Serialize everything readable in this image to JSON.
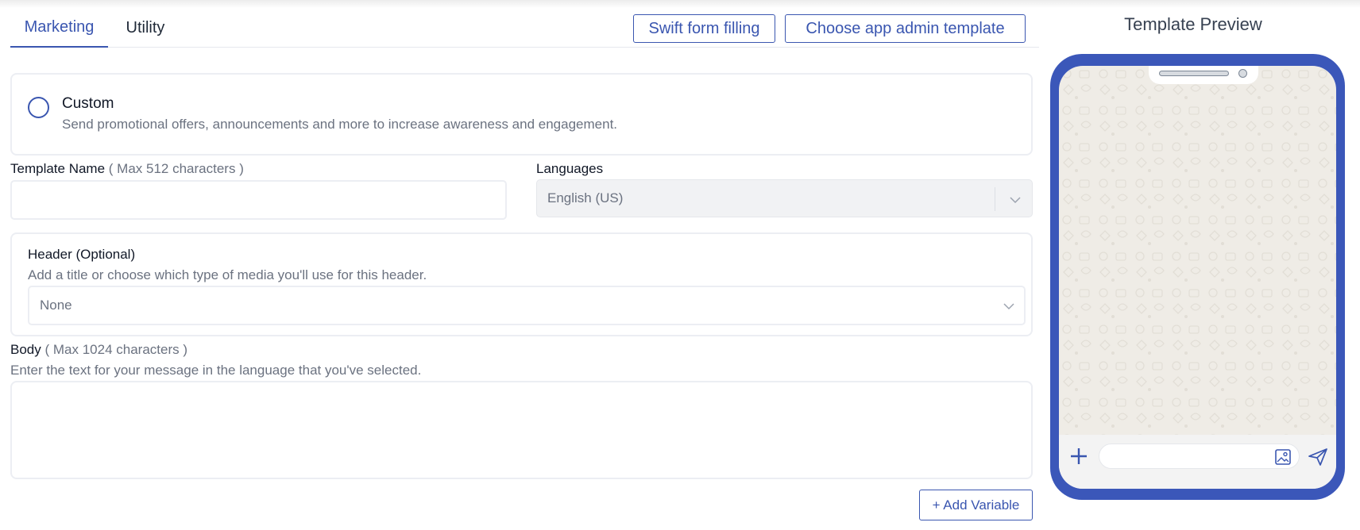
{
  "tabs": [
    {
      "label": "Marketing",
      "active": true
    },
    {
      "label": "Utility",
      "active": false
    }
  ],
  "toolbar": {
    "swift_label": "Swift form filling",
    "choose_template_label": "Choose app admin template"
  },
  "category": {
    "title": "Custom",
    "description": "Send promotional offers, announcements and more to increase awareness and engagement."
  },
  "template_name": {
    "label": "Template Name",
    "hint": "( Max 512 characters )",
    "value": ""
  },
  "languages": {
    "label": "Languages",
    "selected": "English (US)"
  },
  "header": {
    "title": "Header (Optional)",
    "description": "Add a title or choose which type of media you'll use for this header.",
    "selected": "None"
  },
  "body": {
    "label": "Body",
    "hint": "( Max 1024 characters )",
    "description": "Enter the text for your message in the language that you've selected.",
    "value": ""
  },
  "add_variable_label": "+ Add Variable",
  "preview": {
    "title": "Template Preview"
  },
  "colors": {
    "accent": "#3a56b0",
    "phone_frame": "#3b57b9",
    "chat_background": "#efece6"
  }
}
